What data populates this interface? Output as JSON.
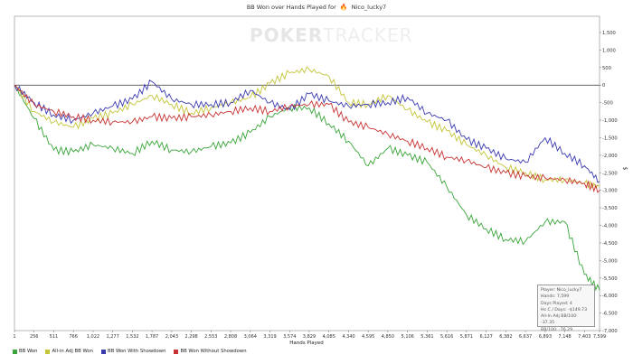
{
  "title": "BB Won over Hands Played for",
  "player_name": "Nico_lucky7",
  "watermark": {
    "left": "POKER",
    "right": "TRACKER"
  },
  "chart_data": {
    "type": "line",
    "title": "BB Won over Hands Played for Nico_lucky7",
    "xlabel": "Hands Played",
    "ylabel": "$",
    "xlim": [
      1,
      7599
    ],
    "ylim": [
      -7000,
      1500
    ],
    "x_ticks": [
      1,
      256,
      511,
      766,
      1022,
      1277,
      1532,
      1787,
      2043,
      2298,
      2553,
      2808,
      3064,
      3319,
      3574,
      3829,
      4085,
      4340,
      4595,
      4850,
      5106,
      5361,
      5616,
      5871,
      6127,
      6382,
      6637,
      6893,
      7148,
      7403,
      7599
    ],
    "y_ticks": [
      1500,
      1000,
      500,
      0,
      -500,
      -1000,
      -1500,
      -2000,
      -2500,
      -3000,
      -3500,
      -4000,
      -4500,
      -5000,
      -5500,
      -6000,
      -6500,
      -7000
    ],
    "y_tick_labels": [
      "1,500",
      "1,000",
      "500",
      "0",
      "-500",
      "-1,000",
      "-1,500",
      "-2,000",
      "-2,500",
      "-3,000",
      "-3,500",
      "-4,000",
      "-4,500",
      "-5,000",
      "-5,500",
      "-6,000",
      "-6,500",
      "-7,000"
    ],
    "x_tick_labels": [
      "1",
      "256",
      "511",
      "766",
      "1,022",
      "1,277",
      "1,532",
      "1,787",
      "2,043",
      "2,298",
      "2,553",
      "2,808",
      "3,064",
      "3,319",
      "3,574",
      "3,829",
      "4,085",
      "4,340",
      "4,595",
      "4,850",
      "5,106",
      "5,361",
      "5,616",
      "5,871",
      "6,127",
      "6,382",
      "6,637",
      "6,893",
      "7,148",
      "7,403",
      "7,599"
    ],
    "x": [
      1,
      256,
      511,
      766,
      1022,
      1277,
      1532,
      1787,
      2043,
      2298,
      2553,
      2808,
      3064,
      3319,
      3574,
      3829,
      4085,
      4340,
      4595,
      4850,
      5106,
      5361,
      5616,
      5871,
      6127,
      6382,
      6637,
      6893,
      7148,
      7403,
      7599
    ],
    "grid": false,
    "legend_position": "bottom-left",
    "series": [
      {
        "name": "BB Won",
        "color": "#3aa53a",
        "values": [
          0,
          -950,
          -1850,
          -1900,
          -1700,
          -1800,
          -1950,
          -1600,
          -1850,
          -1900,
          -1750,
          -1650,
          -1350,
          -900,
          -650,
          -650,
          -1100,
          -1600,
          -2300,
          -1800,
          -2000,
          -2200,
          -2900,
          -3700,
          -4100,
          -4400,
          -4450,
          -3900,
          -3900,
          -5400,
          -5850
        ]
      },
      {
        "name": "All-in Adj BB Won",
        "color": "#c4c43a",
        "values": [
          0,
          -750,
          -1050,
          -1200,
          -950,
          -800,
          -550,
          -300,
          -550,
          -800,
          -650,
          -500,
          -350,
          50,
          350,
          450,
          250,
          -500,
          -550,
          -300,
          -700,
          -1050,
          -1300,
          -1700,
          -2000,
          -2350,
          -2500,
          -2700,
          -2700,
          -2800,
          -2900
        ]
      },
      {
        "name": "BB Won With Showdown",
        "color": "#3a3ab0",
        "values": [
          0,
          -500,
          -850,
          -1000,
          -800,
          -600,
          -400,
          100,
          -400,
          -550,
          -550,
          -500,
          -150,
          -500,
          -700,
          -250,
          -450,
          -600,
          -550,
          -500,
          -350,
          -800,
          -1000,
          -1550,
          -1800,
          -2100,
          -2200,
          -1500,
          -1950,
          -2300,
          -2750
        ]
      },
      {
        "name": "BB Won Without Showdown",
        "color": "#c83232",
        "values": [
          0,
          -550,
          -750,
          -900,
          -1000,
          -1050,
          -1050,
          -900,
          -950,
          -900,
          -850,
          -750,
          -650,
          -750,
          -600,
          -550,
          -550,
          -1050,
          -1200,
          -1400,
          -1600,
          -1800,
          -2050,
          -2150,
          -2350,
          -2500,
          -2600,
          -2650,
          -2700,
          -2800,
          -3000
        ]
      }
    ]
  },
  "infobox": {
    "lines": [
      "Player: Nico_lucky7",
      "Hands: 7,599",
      "Days Played: 4",
      "Hs C / Days: -$149.73",
      "All-In Adj BB/100: -37.35",
      "BB/100: -76.29"
    ]
  }
}
